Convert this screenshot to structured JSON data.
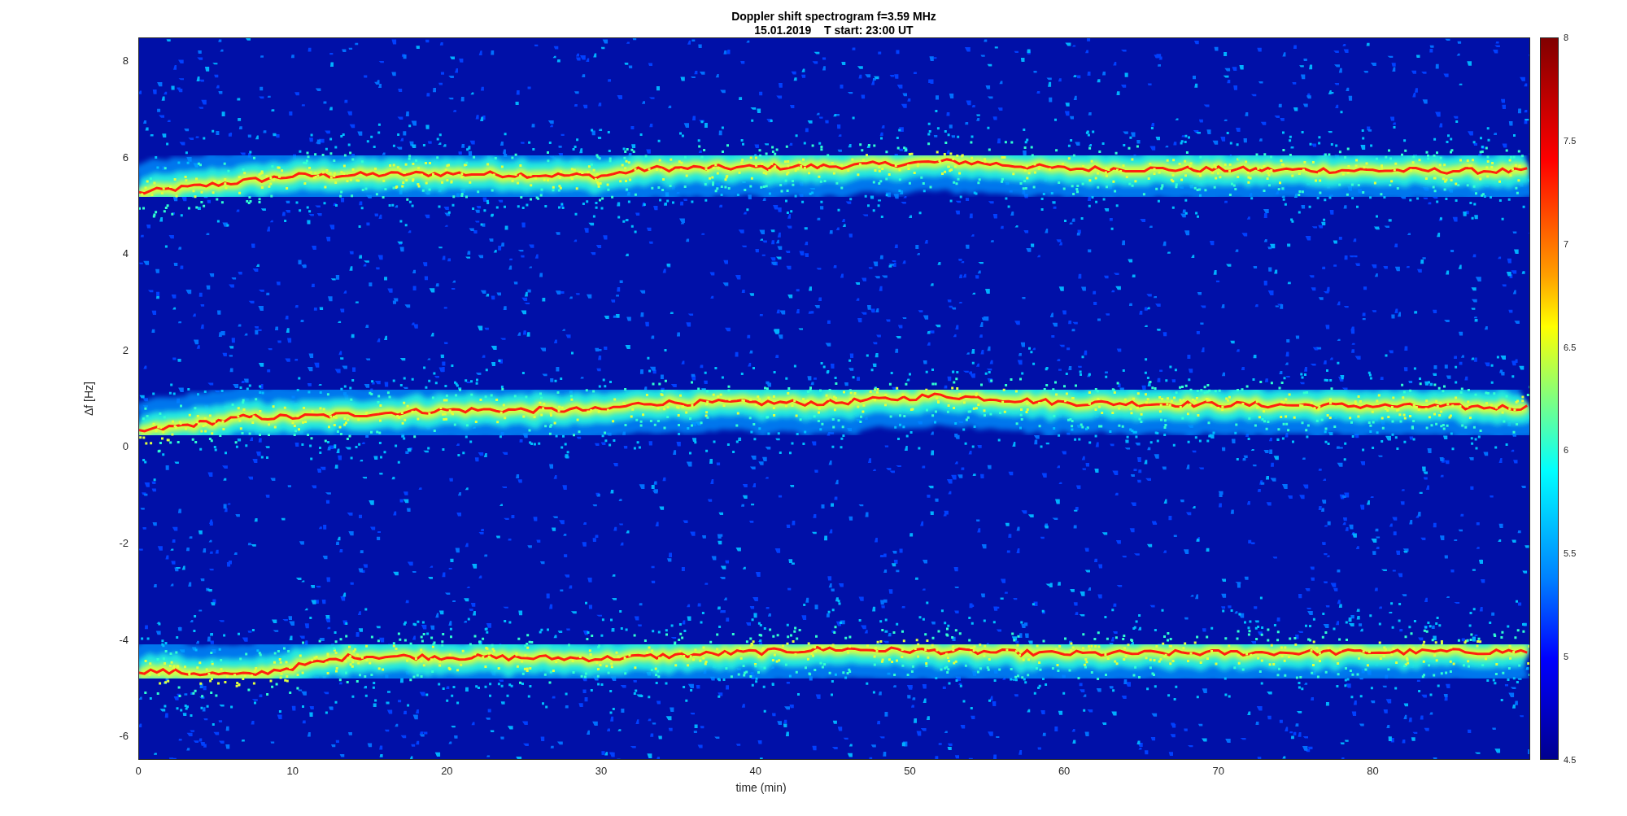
{
  "title": {
    "line_1": "Doppler shift spectrogram f=3.59 MHz",
    "line_2": "15.01.2019    T start: 23:00 UT"
  },
  "y_axis": {
    "label": "Δf [Hz]",
    "ticks": [
      "8",
      "6",
      "4",
      "2",
      "0",
      "-2",
      "-4",
      "-6"
    ]
  },
  "x_axis": {
    "label": "time (min)",
    "ticks": [
      "0",
      "10",
      "20",
      "30",
      "40",
      "50",
      "60",
      "70",
      "80"
    ]
  },
  "colorbar": {
    "ticks": [
      "8",
      "7.5",
      "7",
      "6.5",
      "6",
      "5.5",
      "5",
      "4.5"
    ]
  }
}
